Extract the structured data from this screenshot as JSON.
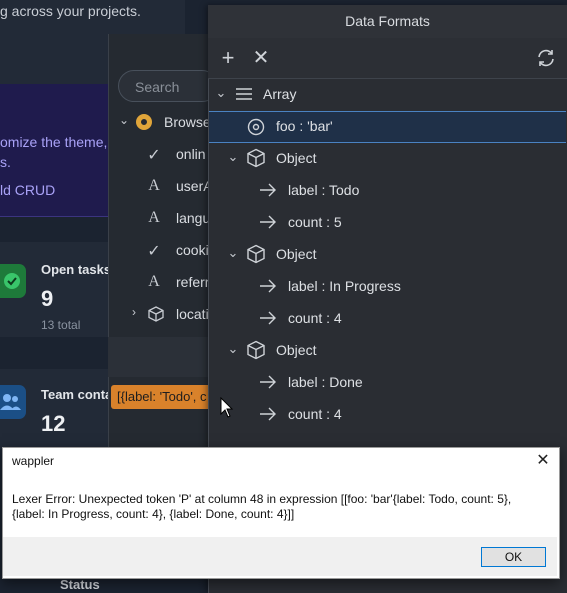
{
  "background_app": {
    "top_text": "g across your projects.",
    "banner_lines": [
      "omize the theme,",
      "s."
    ],
    "banner_link": "ld CRUD",
    "cards": [
      {
        "title": "Open tasks",
        "value": "9",
        "sub": "13 total",
        "icon": "check-icon",
        "color": "#1e7a3a"
      },
      {
        "title": "Team conta",
        "value": "12",
        "sub": "",
        "icon": "people-icon",
        "color": "#1b4f86"
      }
    ],
    "status_header": "Status"
  },
  "tree_panel": {
    "search_placeholder": "Search",
    "items": [
      {
        "label": "Browse",
        "icon": "chrome-icon"
      },
      {
        "label": "onlin",
        "icon": "check-icon"
      },
      {
        "label": "userA",
        "icon": "text-icon"
      },
      {
        "label": "langu",
        "icon": "text-icon"
      },
      {
        "label": "cooki",
        "icon": "check-icon"
      },
      {
        "label": "referr",
        "icon": "text-icon"
      },
      {
        "label": "locati",
        "icon": "cube-icon"
      }
    ],
    "json_preview": "[{label: 'Todo', c"
  },
  "data_formats": {
    "title": "Data Formats",
    "toolbar": {
      "add_icon": "plus-icon",
      "remove_icon": "close-icon",
      "refresh_icon": "refresh-icon"
    },
    "rows": [
      {
        "text": "Array",
        "icon": "list-icon",
        "expanded": true,
        "level": 0
      },
      {
        "text": "foo : 'bar'",
        "icon": "circle-dot-icon",
        "selected": true,
        "level": 1
      },
      {
        "text": "Object",
        "icon": "cube-icon",
        "expanded": true,
        "level": 1
      },
      {
        "text": "label : Todo",
        "icon": "arrow-right-icon",
        "level": 2
      },
      {
        "text": "count : 5",
        "icon": "arrow-right-icon",
        "level": 2
      },
      {
        "text": "Object",
        "icon": "cube-icon",
        "expanded": true,
        "level": 1
      },
      {
        "text": "label : In Progress",
        "icon": "arrow-right-icon",
        "level": 2
      },
      {
        "text": "count : 4",
        "icon": "arrow-right-icon",
        "level": 2
      },
      {
        "text": "Object",
        "icon": "cube-icon",
        "expanded": true,
        "level": 1
      },
      {
        "text": "label : Done",
        "icon": "arrow-right-icon",
        "level": 2
      },
      {
        "text": "count : 4",
        "icon": "arrow-right-icon",
        "level": 2
      }
    ]
  },
  "dialog": {
    "title": "wappler",
    "message": "Lexer Error: Unexpected token 'P' at column 48 in expression [[foo: 'bar'{label: Todo, count:  5}, {label: In Progress, count:  4}, {label: Done, count:  4}]]",
    "ok_label": "OK"
  },
  "colors": {
    "selection": "#1f3048",
    "selection_border": "#4a82c2",
    "ok_border": "#0078d4",
    "json_chip": "#d9822b"
  }
}
